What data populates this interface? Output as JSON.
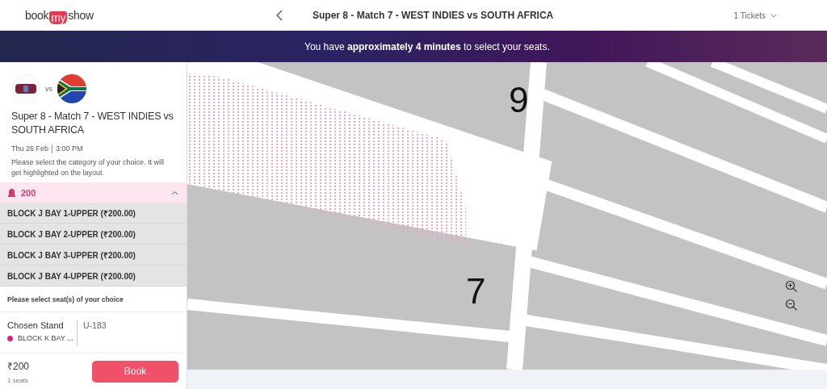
{
  "header": {
    "logo": [
      "book",
      "my",
      "show"
    ],
    "title": "Super 8 - Match 7 - WEST INDIES vs SOUTH AFRICA",
    "tickets": "1 Tickets"
  },
  "banner": "You have **approximately 4 minutes** to select your seats.",
  "event": {
    "vs": "vs",
    "title": "Super 8 - Match 7 - WEST INDIES vs SOUTH AFRICA",
    "date": "Thu 26 Feb",
    "time": "3:00 PM",
    "hint": "Please select the category of your choice. It will get highlighted on the layout."
  },
  "category": {
    "label": "200",
    "expanded": true,
    "blocks": [
      {
        "label": "BLOCK J BAY 1-UPPER (₹200.00)"
      },
      {
        "label": "BLOCK J BAY 2-UPPER (₹200.00)"
      },
      {
        "label": "BLOCK J BAY 3-UPPER (₹200.00)"
      },
      {
        "label": "BLOCK J BAY 4-UPPER (₹200.00)"
      }
    ]
  },
  "seat_prompt": "Please select seat(s) of your choice",
  "chosen": {
    "label": "Chosen Stand",
    "stand": "BLOCK K BAY ...",
    "color": "#e0218a",
    "seat": "U-183"
  },
  "footer": {
    "price": "₹200",
    "count": "1 seats",
    "button": "Book"
  },
  "map": {
    "sections": [
      {
        "label": "9"
      },
      {
        "label": "7"
      }
    ]
  }
}
